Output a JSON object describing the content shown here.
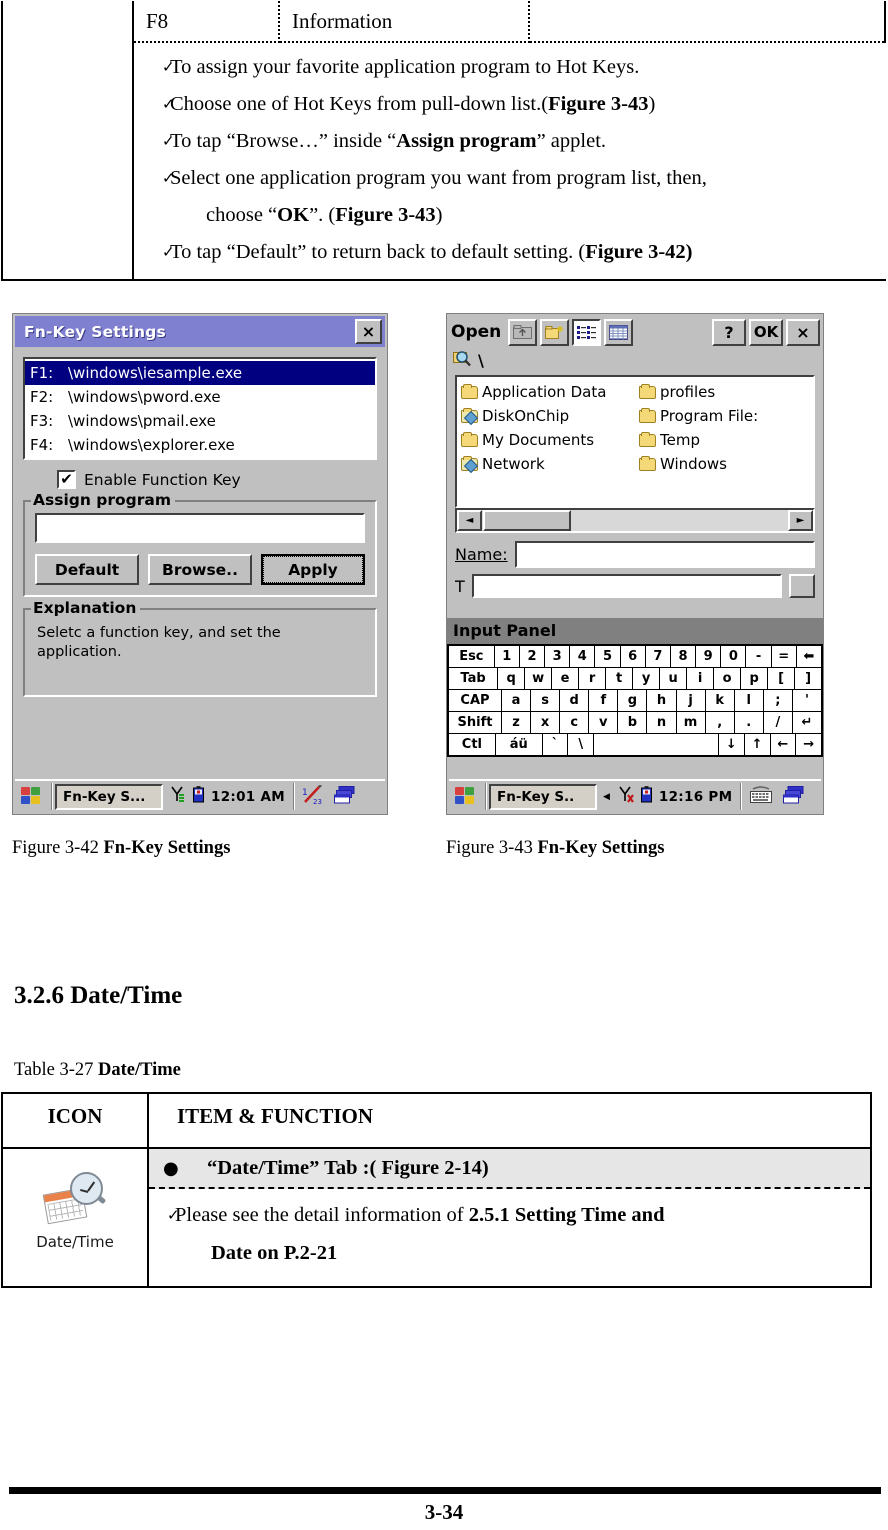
{
  "top_table": {
    "key_row": {
      "key": "F8",
      "name": "Information"
    },
    "bullets": [
      {
        "check": "✓",
        "parts": [
          {
            "t": "To assign your favorite application program to Hot Keys.",
            "b": false
          }
        ]
      },
      {
        "check": "✓",
        "parts": [
          {
            "t": "Choose one of Hot Keys from pull-down list.(",
            "b": false
          },
          {
            "t": "Figure 3-43",
            "b": true
          },
          {
            "t": ")",
            "b": false
          }
        ]
      },
      {
        "check": "✓",
        "parts": [
          {
            "t": "To tap “Browse…” inside “",
            "b": false
          },
          {
            "t": "Assign program",
            "b": true
          },
          {
            "t": "” applet.",
            "b": false
          }
        ]
      },
      {
        "check": "✓",
        "parts": [
          {
            "t": "Select one application program you want from program list, then,",
            "b": false
          }
        ],
        "cont": [
          {
            "t": "choose “",
            "b": false
          },
          {
            "t": "OK",
            "b": true
          },
          {
            "t": "”. (",
            "b": false
          },
          {
            "t": "Figure 3-43",
            "b": true
          },
          {
            "t": ")",
            "b": false
          }
        ]
      },
      {
        "check": "✓",
        "parts": [
          {
            "t": "To tap “Default” to return back to default setting. (",
            "b": false
          },
          {
            "t": "Figure 3-42)",
            "b": true
          }
        ]
      }
    ]
  },
  "fig1": {
    "title": "Fn-Key Settings",
    "close_icon": "×",
    "list": [
      {
        "key": "F1:",
        "path": "\\windows\\iesample.exe",
        "selected": true
      },
      {
        "key": "F2:",
        "path": "\\windows\\pword.exe",
        "selected": false
      },
      {
        "key": "F3:",
        "path": "\\windows\\pmail.exe",
        "selected": false
      },
      {
        "key": "F4:",
        "path": "\\windows\\explorer.exe",
        "selected": false
      }
    ],
    "checkbox": {
      "checked_glyph": "✔",
      "label": "Enable Function Key"
    },
    "assign_group": {
      "title": "Assign program",
      "input_value": ""
    },
    "buttons": {
      "default": "Default",
      "browse": "Browse..",
      "apply": "Apply"
    },
    "explanation": {
      "title": "Explanation",
      "text": "Seletc a function key, and set the application."
    },
    "taskbar": {
      "task": "Fn-Key S...",
      "clock": "12:01 AM"
    }
  },
  "fig2": {
    "title": "Open",
    "toolbar_icons": [
      "up-one-level-icon",
      "new-folder-icon",
      "list-view-icon",
      "details-view-icon"
    ],
    "help_label": "?",
    "ok_label": "OK",
    "close_label": "×",
    "path": "\\",
    "files_col1": [
      {
        "name": "Application Data",
        "type": "folder"
      },
      {
        "name": "DiskOnChip",
        "type": "special"
      },
      {
        "name": "My Documents",
        "type": "folder"
      },
      {
        "name": "Network",
        "type": "special"
      }
    ],
    "files_col2": [
      {
        "name": "profiles",
        "type": "folder"
      },
      {
        "name": "Program File:",
        "type": "folder"
      },
      {
        "name": "Temp",
        "type": "folder"
      },
      {
        "name": "Windows",
        "type": "folder"
      }
    ],
    "scroll": {
      "left_arrow": "◄",
      "right_arrow": "►"
    },
    "name_label": "Name:",
    "name_value": "",
    "type_value": "",
    "input_panel": {
      "title": "Input Panel",
      "rows": [
        [
          "Esc",
          "1",
          "2",
          "3",
          "4",
          "5",
          "6",
          "7",
          "8",
          "9",
          "0",
          "-",
          "=",
          "⬅"
        ],
        [
          "Tab",
          "q",
          "w",
          "e",
          "r",
          "t",
          "y",
          "u",
          "i",
          "o",
          "p",
          "[",
          "]"
        ],
        [
          "CAP",
          "a",
          "s",
          "d",
          "f",
          "g",
          "h",
          "j",
          "k",
          "l",
          ";",
          "'"
        ],
        [
          "Shift",
          "z",
          "x",
          "c",
          "v",
          "b",
          "n",
          "m",
          ",",
          ".",
          "/",
          "↵"
        ],
        [
          "Ctl",
          "áü",
          "`",
          "\\",
          " ",
          "↓",
          "↑",
          "←",
          "→"
        ]
      ]
    },
    "taskbar": {
      "task": "Fn-Key S..",
      "clock": "12:16 PM"
    }
  },
  "captions": {
    "fig1": {
      "prefix": "Figure 3-42 ",
      "bold": "Fn-Key Settings"
    },
    "fig2": {
      "prefix": "Figure 3-43 ",
      "bold": "Fn-Key Settings"
    }
  },
  "section": {
    "heading": "3.2.6 Date/Time"
  },
  "table_caption": {
    "prefix": "Table 3-27 ",
    "bold": "Date/Time"
  },
  "bot_table": {
    "headers": {
      "icon": "ICON",
      "item": "ITEM & FUNCTION"
    },
    "icon_label": "Date/Time",
    "shaded_row": {
      "bullet": "●",
      "parts": [
        {
          "t": "“Date/Time” Tab",
          "b": true
        },
        {
          "t": " :(",
          "b": false
        },
        {
          "t": " Figure 2-14",
          "b": true
        },
        {
          "t": ")",
          "b": false
        }
      ]
    },
    "detail_row": {
      "check": "✓",
      "parts": [
        {
          "t": "Please see the detail information of ",
          "b": false
        },
        {
          "t": "2.5.1 Setting Time and",
          "b": true
        }
      ],
      "cont": [
        {
          "t": "Date on P.2-21",
          "b": true
        }
      ]
    }
  },
  "footer": {
    "page": "3-34"
  }
}
